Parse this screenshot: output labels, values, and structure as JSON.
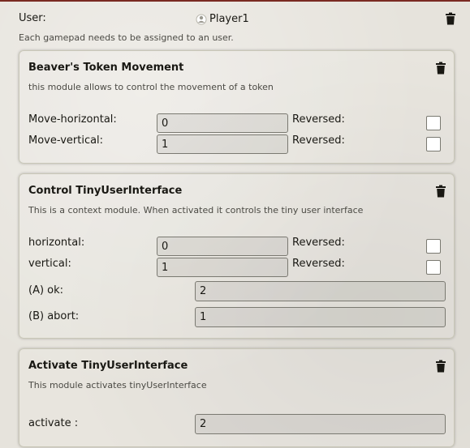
{
  "user": {
    "label": "User:",
    "value": "Player1",
    "note": "Each gamepad needs to be assigned to an user."
  },
  "modules": [
    {
      "title": "Beaver's Token Movement",
      "description": "this module allows to control the movement of a token",
      "axes": [
        {
          "label": "Move-horizontal:",
          "value": "0",
          "reversed_label": "Reversed:",
          "reversed": false
        },
        {
          "label": "Move-vertical:",
          "value": "1",
          "reversed_label": "Reversed:",
          "reversed": false
        }
      ]
    },
    {
      "title": "Control TinyUserInterface",
      "description": "This is a context module. When activated it controls the tiny user interface",
      "axes": [
        {
          "label": "horizontal:",
          "value": "0",
          "reversed_label": "Reversed:",
          "reversed": false
        },
        {
          "label": "vertical:",
          "value": "1",
          "reversed_label": "Reversed:",
          "reversed": false
        }
      ],
      "buttons": [
        {
          "label": "(A) ok:",
          "value": "2"
        },
        {
          "label": "(B) abort:",
          "value": "1"
        }
      ]
    },
    {
      "title": "Activate TinyUserInterface",
      "description": "This module activates tinyUserInterface",
      "buttons": [
        {
          "label": "activate :",
          "value": "2"
        }
      ]
    }
  ],
  "colors": {
    "accent": "#7a2a22",
    "text": "#191813"
  },
  "icons": {
    "delete": "trash-icon",
    "user": "user-icon"
  }
}
